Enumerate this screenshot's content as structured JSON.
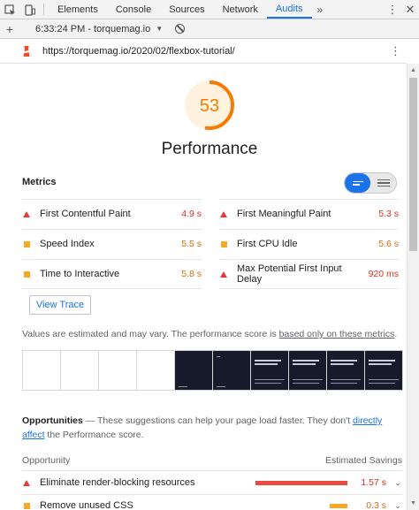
{
  "devtools": {
    "tabs": [
      {
        "label": "Elements",
        "active": false
      },
      {
        "label": "Console",
        "active": false
      },
      {
        "label": "Sources",
        "active": false
      },
      {
        "label": "Network",
        "active": false
      },
      {
        "label": "Audits",
        "active": true
      }
    ],
    "more_tabs": "»",
    "report_label": "6:33:24 PM - torquemag.io"
  },
  "url": "https://torquemag.io/2020/02/flexbox-tutorial/",
  "score": {
    "value": "53",
    "fraction": 0.53,
    "color": "#f57c00",
    "bg_color": "#fff3e0"
  },
  "category_title": "Performance",
  "metrics": {
    "label": "Metrics",
    "items": [
      {
        "name": "First Contentful Paint",
        "value": "4.9 s",
        "status": "fail"
      },
      {
        "name": "First Meaningful Paint",
        "value": "5.3 s",
        "status": "fail"
      },
      {
        "name": "Speed Index",
        "value": "5.5 s",
        "status": "average"
      },
      {
        "name": "First CPU Idle",
        "value": "5.6 s",
        "status": "average"
      },
      {
        "name": "Time to Interactive",
        "value": "5.8 s",
        "status": "average"
      },
      {
        "name": "Max Potential First Input Delay",
        "value": "920 ms",
        "status": "fail"
      }
    ]
  },
  "view_trace": "View Trace",
  "note": {
    "text": "Values are estimated and may vary. The performance score is ",
    "link": "based only on these metrics",
    "end": "."
  },
  "filmstrip": {
    "frames": 10
  },
  "opportunities": {
    "title": "Opportunities",
    "dash": " — ",
    "desc": "These suggestions can help your page load faster. They don't ",
    "link": "directly affect",
    "desc_end": " the Performance score.",
    "col_opportunity": "Opportunity",
    "col_savings": "Estimated Savings",
    "items": [
      {
        "name": "Eliminate render-blocking resources",
        "value": "1.57 s",
        "status": "fail",
        "bar_fraction": 1.0,
        "bar_color": "#eb4b3f"
      },
      {
        "name": "Remove unused CSS",
        "value": "0.3 s",
        "status": "average",
        "bar_fraction": 0.19,
        "bar_color": "#f9a825"
      }
    ]
  },
  "colors": {
    "fail": "#d93025",
    "average": "#d56e0c",
    "accent": "#1a73e8"
  }
}
